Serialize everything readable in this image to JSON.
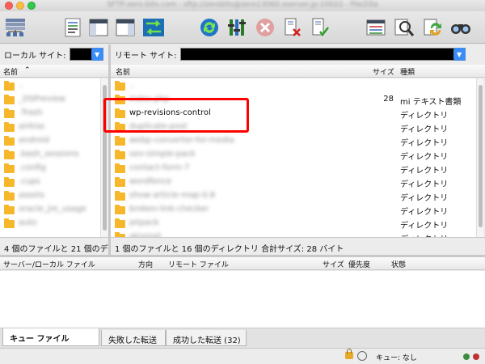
{
  "window": {
    "title": "SFTP-zero-bits.com - sftp://zerobits@zero13060.xserver.jp:10022 - FileZilla"
  },
  "local": {
    "site_label": "ローカル サイト:",
    "col_name": "名前",
    "sort_arrow": "⌃",
    "files": [
      {
        "name": "..",
        "blurred": true
      },
      {
        "name": "_DSPreview",
        "blurred": true
      },
      {
        "name": ".Trash",
        "blurred": true
      },
      {
        "name": "airkiss",
        "blurred": true
      },
      {
        "name": "android",
        "blurred": true
      },
      {
        "name": ".bash_sessions",
        "blurred": true
      },
      {
        "name": ".config",
        "blurred": true
      },
      {
        "name": ".cups",
        "blurred": true
      },
      {
        "name": "assets",
        "blurred": true
      },
      {
        "name": "oracle_jre_usage",
        "blurred": true
      },
      {
        "name": "auto",
        "blurred": true
      }
    ],
    "status": "4 個のファイルと 21 個のデ"
  },
  "remote": {
    "site_label": "リモート サイト:",
    "col_name": "名前",
    "col_size": "サイズ",
    "col_type": "種類",
    "files": [
      {
        "name": "..",
        "size": "",
        "type": "",
        "blurred": true
      },
      {
        "name": "index.php",
        "size": "28",
        "type": "mi テキスト書類",
        "blurred": true
      },
      {
        "name": "wp-revisions-control",
        "size": "",
        "type": "ディレクトリ",
        "blurred": false
      },
      {
        "name": "duplicate-post",
        "size": "",
        "type": "ディレクトリ",
        "blurred": true
      },
      {
        "name": "webp-converter-for-media",
        "size": "",
        "type": "ディレクトリ",
        "blurred": true
      },
      {
        "name": "seo-simple-pack",
        "size": "",
        "type": "ディレクトリ",
        "blurred": true
      },
      {
        "name": "contact-form-7",
        "size": "",
        "type": "ディレクトリ",
        "blurred": true
      },
      {
        "name": "wordfence",
        "size": "",
        "type": "ディレクトリ",
        "blurred": true
      },
      {
        "name": "show-article-map-0.8",
        "size": "",
        "type": "ディレクトリ",
        "blurred": true
      },
      {
        "name": "broken-link-checker",
        "size": "",
        "type": "ディレクトリ",
        "blurred": true
      },
      {
        "name": "jetpack",
        "size": "",
        "type": "ディレクトリ",
        "blurred": true
      },
      {
        "name": "akismet",
        "size": "",
        "type": "ディレクトリ",
        "blurred": true
      }
    ],
    "status": "1 個のファイルと 16 個のディレクトリ 合計サイズ: 28 バイト"
  },
  "queue": {
    "col_server": "サーバー/ローカル ファイル",
    "col_direction": "方向",
    "col_remote": "リモート ファイル",
    "col_size": "サイズ",
    "col_priority": "優先度",
    "col_status": "状態"
  },
  "tabs": [
    {
      "label": "キュー ファイル"
    },
    {
      "label": "失敗した転送"
    },
    {
      "label": "成功した転送 (32)"
    }
  ],
  "bottom": {
    "queue_status": "キュー: なし"
  },
  "colors": {
    "accent": "#3b8cf5",
    "highlight": "#ff0000",
    "folder": "#f6b72b"
  },
  "icons": [
    "site-manager-icon",
    "message-log-icon",
    "local-tree-icon",
    "remote-tree-icon",
    "transfer-queue-icon",
    "refresh-icon",
    "process-queue-icon",
    "cancel-icon",
    "disconnect-icon",
    "reconnect-icon",
    "filter-icon",
    "compare-icon",
    "sync-browse-icon",
    "find-icon"
  ]
}
